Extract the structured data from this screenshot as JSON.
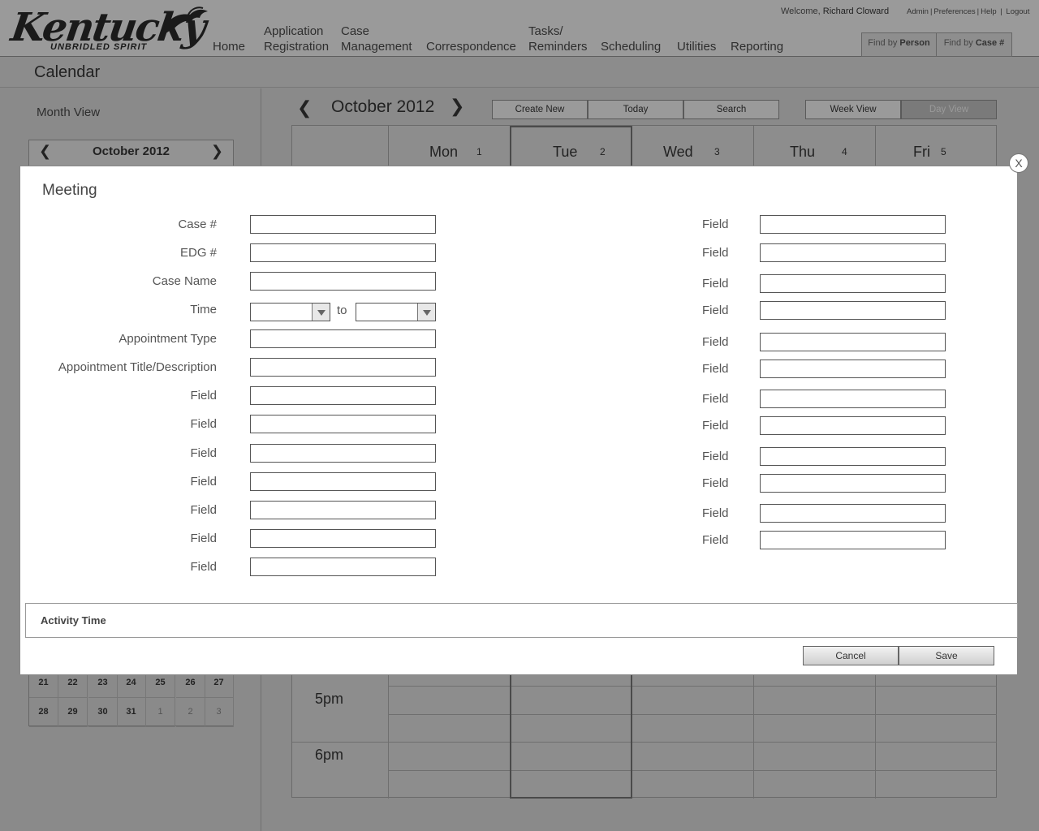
{
  "header": {
    "logo_word": "Kentucky",
    "logo_tagline": "UNBRIDLED SPIRIT",
    "nav": [
      {
        "line1": "Home",
        "line2": ""
      },
      {
        "line1": "Application",
        "line2": "Registration"
      },
      {
        "line1": "Case",
        "line2": "Management"
      },
      {
        "line1": "Correspondence",
        "line2": ""
      },
      {
        "line1": "Tasks/",
        "line2": "Reminders"
      },
      {
        "line1": "Scheduling",
        "line2": ""
      },
      {
        "line1": "Utilities",
        "line2": ""
      },
      {
        "line1": "Reporting",
        "line2": ""
      }
    ],
    "welcome_prefix": "Welcome,",
    "user_name": "Richard Cloward",
    "top_links": [
      "Admin",
      "Preferences",
      "Help",
      "Logout"
    ],
    "find_by_person_prefix": "Find by",
    "find_by_person_bold": "Person",
    "find_by_case_prefix": "Find by",
    "find_by_case_bold": "Case #"
  },
  "page_title": "Calendar",
  "left_panel": {
    "month_view_label": "Month View",
    "mini_calendar_title": "October 2012",
    "mini_rows": [
      [
        {
          "d": "21",
          "o": false
        },
        {
          "d": "22",
          "o": false
        },
        {
          "d": "23",
          "o": false
        },
        {
          "d": "24",
          "o": false
        },
        {
          "d": "25",
          "o": false
        },
        {
          "d": "26",
          "o": false
        },
        {
          "d": "27",
          "o": false
        }
      ],
      [
        {
          "d": "28",
          "o": false
        },
        {
          "d": "29",
          "o": false
        },
        {
          "d": "30",
          "o": false
        },
        {
          "d": "31",
          "o": false
        },
        {
          "d": "1",
          "o": true
        },
        {
          "d": "2",
          "o": true
        },
        {
          "d": "3",
          "o": true
        }
      ]
    ]
  },
  "calendar": {
    "month_title": "October 2012",
    "toolbar": {
      "create_new": "Create New",
      "today": "Today",
      "search": "Search",
      "week_view": "Week View",
      "day_view": "Day View"
    },
    "days": [
      {
        "name": "Mon",
        "num": "1"
      },
      {
        "name": "Tue",
        "num": "2"
      },
      {
        "name": "Wed",
        "num": "3"
      },
      {
        "name": "Thu",
        "num": "4"
      },
      {
        "name": "Fri",
        "num": "5"
      }
    ],
    "hours": [
      "5pm",
      "6pm"
    ]
  },
  "modal": {
    "title": "Meeting",
    "close_label": "X",
    "left_fields": [
      {
        "label": "Case #",
        "value": ""
      },
      {
        "label": "EDG #",
        "value": ""
      },
      {
        "label": "Case Name",
        "value": ""
      },
      {
        "label": "Time",
        "value": ""
      },
      {
        "label": "Appointment Type",
        "value": ""
      },
      {
        "label": "Appointment Title/Description",
        "value": ""
      },
      {
        "label": "Field",
        "value": ""
      },
      {
        "label": "Field",
        "value": ""
      },
      {
        "label": "Field",
        "value": ""
      },
      {
        "label": "Field",
        "value": ""
      },
      {
        "label": "Field",
        "value": ""
      },
      {
        "label": "Field",
        "value": ""
      },
      {
        "label": "Field",
        "value": ""
      }
    ],
    "time_from": "",
    "time_to": "",
    "time_to_label": "to",
    "right_fields": [
      {
        "label": "Field",
        "value": ""
      },
      {
        "label": "Field",
        "value": ""
      },
      {
        "label": "Field",
        "value": ""
      },
      {
        "label": "Field",
        "value": ""
      },
      {
        "label": "Field",
        "value": ""
      },
      {
        "label": "Field",
        "value": ""
      },
      {
        "label": "Field",
        "value": ""
      },
      {
        "label": "Field",
        "value": ""
      },
      {
        "label": "Field",
        "value": ""
      },
      {
        "label": "Field",
        "value": ""
      },
      {
        "label": "Field",
        "value": ""
      },
      {
        "label": "Field",
        "value": ""
      }
    ],
    "activity_time_label": "Activity Time",
    "cancel_label": "Cancel",
    "save_label": "Save"
  }
}
